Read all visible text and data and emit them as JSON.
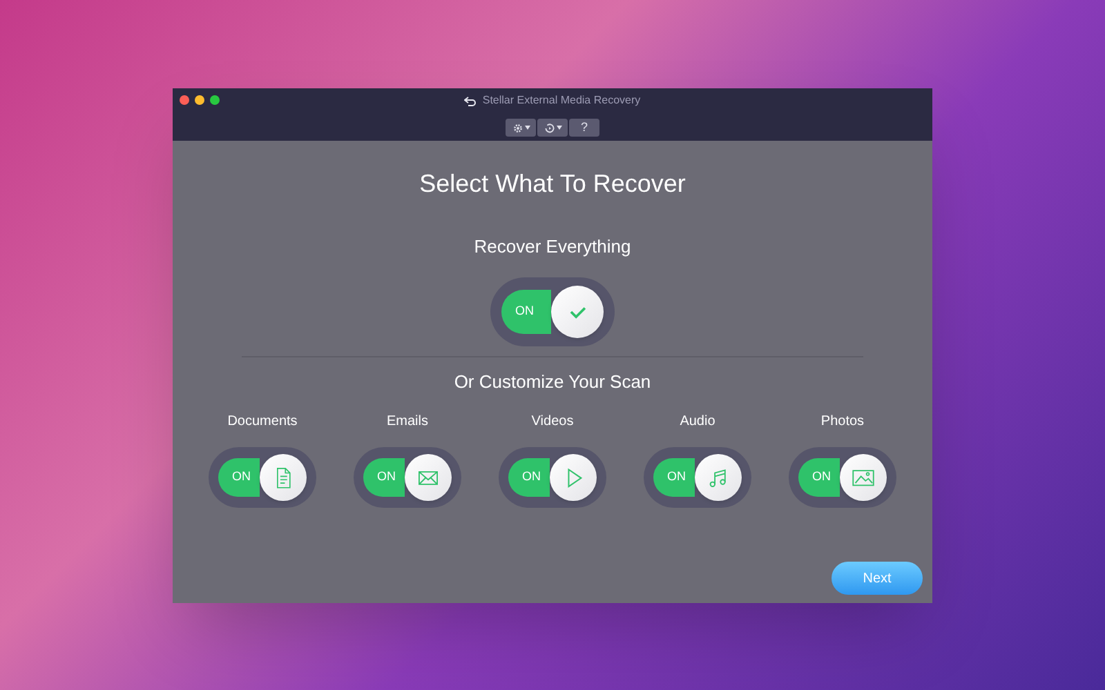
{
  "window": {
    "title": "Stellar External Media Recovery"
  },
  "toolbar": {
    "help": "?"
  },
  "heading": "Select What To Recover",
  "recover_everything": {
    "label": "Recover Everything",
    "toggle_text": "ON",
    "on": true
  },
  "customize_heading": "Or Customize Your Scan",
  "categories": [
    {
      "label": "Documents",
      "kind": "document",
      "toggle_text": "ON",
      "on": true
    },
    {
      "label": "Emails",
      "kind": "email",
      "toggle_text": "ON",
      "on": true
    },
    {
      "label": "Videos",
      "kind": "video",
      "toggle_text": "ON",
      "on": true
    },
    {
      "label": "Audio",
      "kind": "audio",
      "toggle_text": "ON",
      "on": true
    },
    {
      "label": "Photos",
      "kind": "photo",
      "toggle_text": "ON",
      "on": true
    }
  ],
  "next_button": "Next"
}
